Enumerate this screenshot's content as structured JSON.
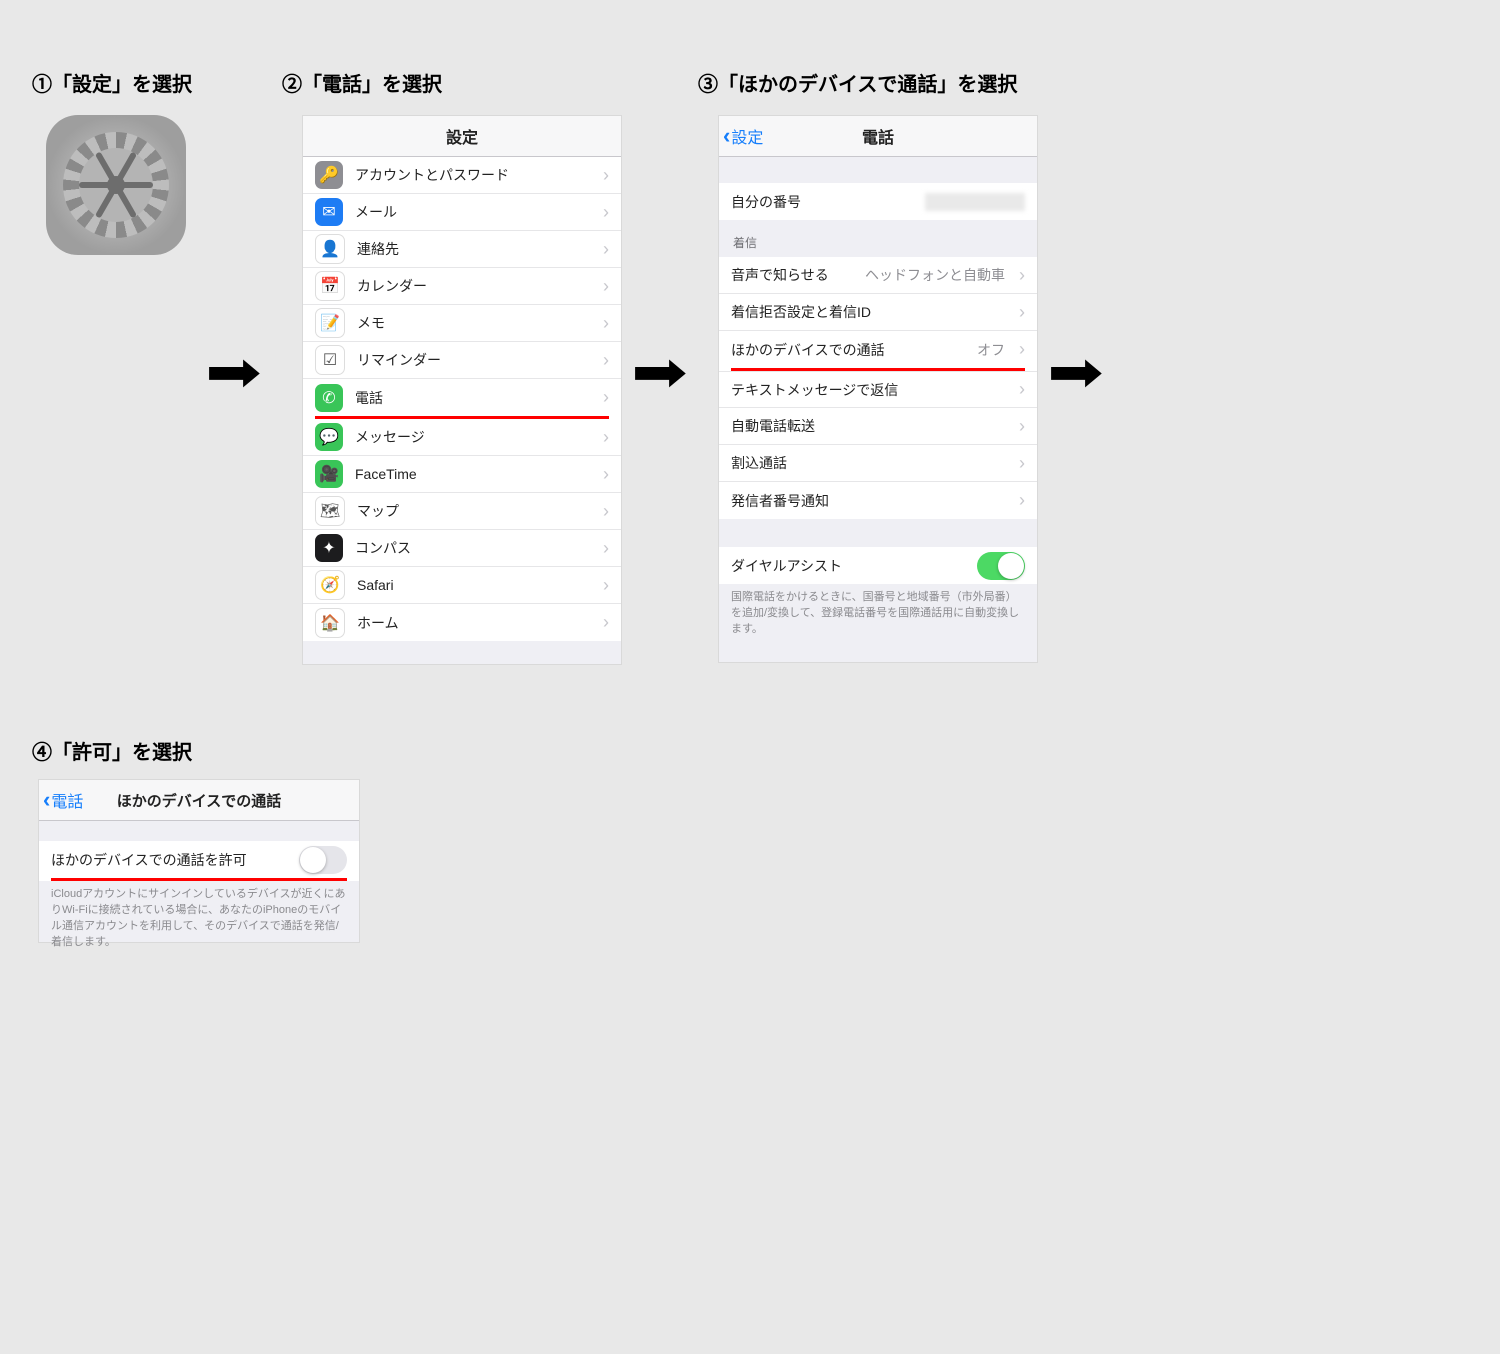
{
  "steps": {
    "s1": "①「設定」を選択",
    "s2": "②「電話」を選択",
    "s3": "③「ほかのデバイスで通話」を選択",
    "s4": "④「許可」を選択"
  },
  "panel2": {
    "title": "設定",
    "items": [
      {
        "label": "アカウントとパスワード",
        "bg": "#8e8e93",
        "glyph": "🔑"
      },
      {
        "label": "メール",
        "bg": "#1e7cf4",
        "glyph": "✉"
      },
      {
        "label": "連絡先",
        "bg": "#ffffff",
        "glyph": "👤"
      },
      {
        "label": "カレンダー",
        "bg": "#ffffff",
        "glyph": "📅"
      },
      {
        "label": "メモ",
        "bg": "#ffffff",
        "glyph": "📝"
      },
      {
        "label": "リマインダー",
        "bg": "#ffffff",
        "glyph": "☑"
      },
      {
        "label": "電話",
        "bg": "#39c558",
        "glyph": "✆"
      },
      {
        "label": "メッセージ",
        "bg": "#39c558",
        "glyph": "💬"
      },
      {
        "label": "FaceTime",
        "bg": "#39c558",
        "glyph": "🎥"
      },
      {
        "label": "マップ",
        "bg": "#ffffff",
        "glyph": "🗺"
      },
      {
        "label": "コンパス",
        "bg": "#1c1c1e",
        "glyph": "✦"
      },
      {
        "label": "Safari",
        "bg": "#ffffff",
        "glyph": "🧭"
      },
      {
        "label": "ホーム",
        "bg": "#ffffff",
        "glyph": "🏠"
      }
    ]
  },
  "panel3": {
    "back": "設定",
    "title": "電話",
    "my_number_label": "自分の番号",
    "section_calls": "着信",
    "rows": {
      "announce": {
        "label": "音声で知らせる",
        "value": "ヘッドフォンと自動車"
      },
      "block": {
        "label": "着信拒否設定と着信ID"
      },
      "other": {
        "label": "ほかのデバイスでの通話",
        "value": "オフ"
      },
      "sms": {
        "label": "テキストメッセージで返信"
      },
      "fwd": {
        "label": "自動電話転送"
      },
      "wait": {
        "label": "割込通話"
      },
      "callerid": {
        "label": "発信者番号通知"
      }
    },
    "dial_assist": "ダイヤルアシスト",
    "dial_assist_note": "国際電話をかけるときに、国番号と地域番号（市外局番）を追加/変換して、登録電話番号を国際通話用に自動変換します。"
  },
  "panel4": {
    "back": "電話",
    "title": "ほかのデバイスでの通話",
    "allow": "ほかのデバイスでの通話を許可",
    "note": "iCloudアカウントにサインインしているデバイスが近くにありWi-Fiに接続されている場合に、あなたのiPhoneのモバイル通信アカウントを利用して、そのデバイスで通話を発信/着信します。"
  }
}
